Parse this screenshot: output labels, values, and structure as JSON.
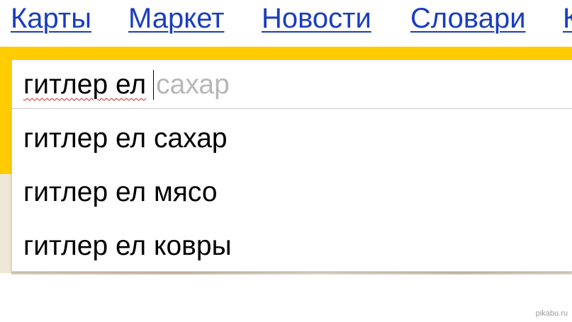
{
  "nav": {
    "items": [
      "Карты",
      "Маркет",
      "Новости",
      "Словари",
      "К"
    ]
  },
  "search": {
    "typed": "гитлер ел",
    "completion_hint": "сахар"
  },
  "suggestions": [
    "гитлер ел сахар",
    "гитлер ел мясо",
    "гитлер ел ковры"
  ],
  "watermark": "pikabu.ru",
  "colors": {
    "link": "#1a3dbf",
    "search_frame": "#ffcc00",
    "hint": "#b7b7b7",
    "spellcheck": "#d42020"
  }
}
